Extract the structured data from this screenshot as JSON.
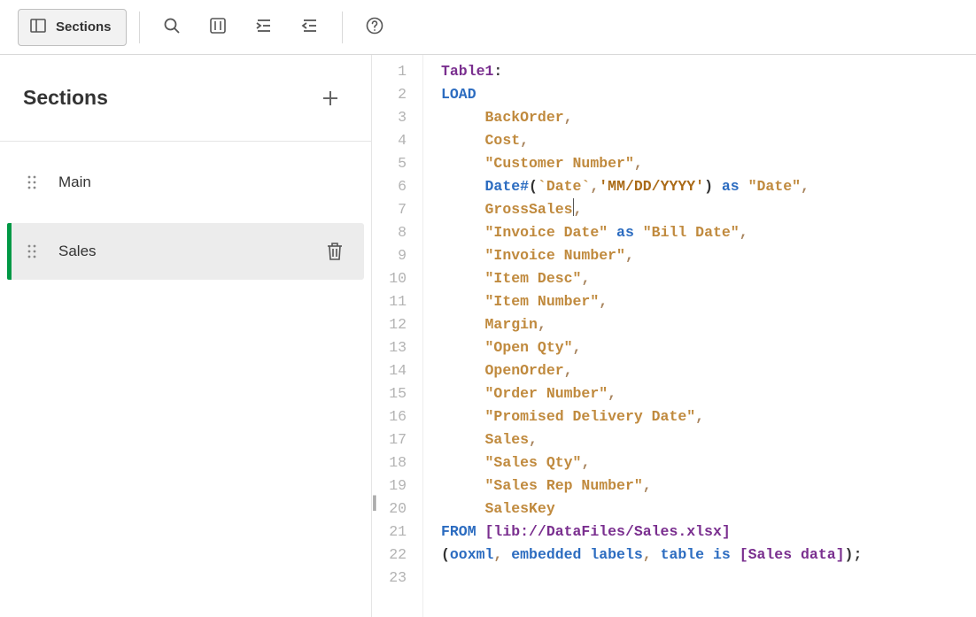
{
  "toolbar": {
    "sections_label": "Sections"
  },
  "sidebar": {
    "title": "Sections",
    "items": [
      {
        "label": "Main",
        "selected": false
      },
      {
        "label": "Sales",
        "selected": true
      }
    ]
  },
  "editor": {
    "line_numbers": [
      1,
      2,
      3,
      4,
      5,
      6,
      7,
      8,
      9,
      10,
      11,
      12,
      13,
      14,
      15,
      16,
      17,
      18,
      19,
      20,
      21,
      22,
      23
    ],
    "cursor_line": 7,
    "cursor_after": "GrossSales",
    "script": {
      "table": "Table1",
      "load_fields": [
        {
          "kind": "field",
          "text": "BackOrder"
        },
        {
          "kind": "field",
          "text": "Cost"
        },
        {
          "kind": "quoted",
          "text": "\"Customer Number\""
        },
        {
          "kind": "datefn",
          "func": "Date#",
          "arg_back": "`Date`",
          "arg_fmt": "'MM/DD/YYYY'",
          "alias": "\"Date\""
        },
        {
          "kind": "field",
          "text": "GrossSales",
          "cursor_after": true
        },
        {
          "kind": "alias",
          "text": "\"Invoice Date\"",
          "alias": "\"Bill Date\""
        },
        {
          "kind": "quoted",
          "text": "\"Invoice Number\""
        },
        {
          "kind": "quoted",
          "text": "\"Item Desc\""
        },
        {
          "kind": "quoted",
          "text": "\"Item Number\""
        },
        {
          "kind": "field",
          "text": "Margin"
        },
        {
          "kind": "quoted",
          "text": "\"Open Qty\""
        },
        {
          "kind": "field",
          "text": "OpenOrder"
        },
        {
          "kind": "quoted",
          "text": "\"Order Number\""
        },
        {
          "kind": "quoted",
          "text": "\"Promised Delivery Date\""
        },
        {
          "kind": "field",
          "text": "Sales"
        },
        {
          "kind": "quoted",
          "text": "\"Sales Qty\""
        },
        {
          "kind": "quoted",
          "text": "\"Sales Rep Number\""
        },
        {
          "kind": "field",
          "text": "SalesKey",
          "last": true
        }
      ],
      "from_path": "[lib://DataFiles/Sales.xlsx]",
      "from_opts_pre": "ooxml",
      "from_opts_mid": "embedded labels",
      "from_opts_tbl_kw": "table is",
      "from_opts_tbl": "[Sales data]"
    }
  }
}
